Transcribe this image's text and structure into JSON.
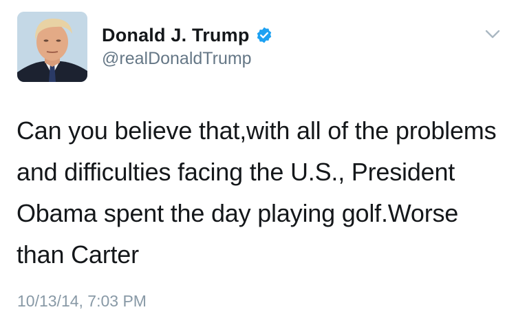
{
  "author": {
    "display_name": "Donald J. Trump",
    "handle": "@realDonaldTrump",
    "verified": true
  },
  "icons": {
    "avatar": "profile-photo",
    "verified": "verified-badge-icon",
    "menu": "chevron-down-icon"
  },
  "tweet": {
    "text": "Can you believe that,with all of the problems and difficulties facing the U.S., President Obama spent the day playing golf.Worse than Carter",
    "timestamp": "10/13/14, 7:03 PM"
  },
  "colors": {
    "verified_blue": "#1da1f2",
    "secondary_text": "#657786",
    "timestamp_text": "#8899a6",
    "chevron": "#aab8c2"
  }
}
